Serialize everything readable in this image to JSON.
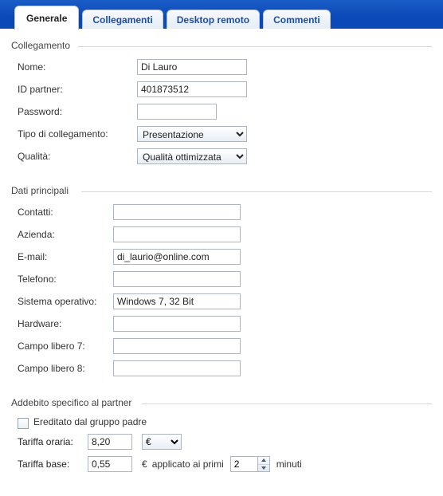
{
  "tabs": {
    "generale": "Generale",
    "collegamenti": "Collegamenti",
    "desktop_remoto": "Desktop remoto",
    "commenti": "Commenti"
  },
  "collegamento": {
    "legend": "Collegamento",
    "nome_label": "Nome:",
    "nome_value": "Di Lauro",
    "id_partner_label": "ID partner:",
    "id_partner_value": "401873512",
    "password_label": "Password:",
    "password_value": "",
    "tipo_label": "Tipo di collegamento:",
    "tipo_value": "Presentazione",
    "qualita_label": "Qualità:",
    "qualita_value": "Qualità ottimizzata"
  },
  "dati": {
    "legend": "Dati principali",
    "contatti_label": "Contatti:",
    "contatti_value": "",
    "azienda_label": "Azienda:",
    "azienda_value": "",
    "email_label": "E-mail:",
    "email_value": "di_laurio@online.com",
    "telefono_label": "Telefono:",
    "telefono_value": "",
    "so_label": "Sistema operativo:",
    "so_value": "Windows 7, 32 Bit",
    "hardware_label": "Hardware:",
    "hardware_value": "",
    "campo7_label": "Campo libero 7:",
    "campo7_value": "",
    "campo8_label": "Campo libero 8:",
    "campo8_value": ""
  },
  "addebito": {
    "legend": "Addebito specifico al partner",
    "ereditato_label": "Ereditato dal gruppo padre",
    "tariffa_oraria_label": "Tariffa oraria:",
    "tariffa_oraria_value": "8,20",
    "valuta": "€",
    "tariffa_base_label": "Tariffa base:",
    "tariffa_base_value": "0,55",
    "valuta2": "€",
    "applicato_label": "applicato ai primi",
    "minuti_value": "2",
    "minuti_label": "minuti"
  }
}
